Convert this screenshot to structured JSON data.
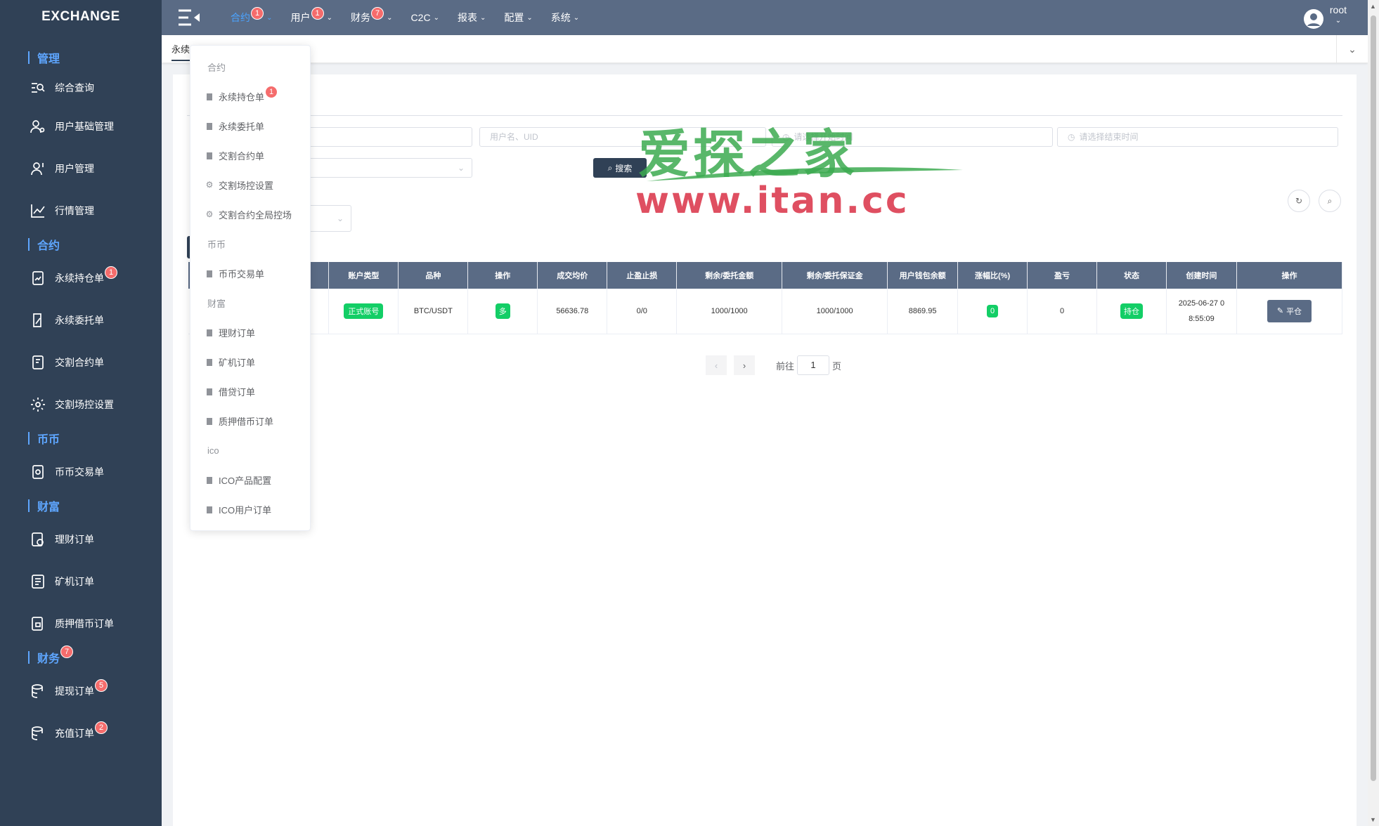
{
  "app": {
    "title": "EXCHANGE"
  },
  "sidebar": {
    "groups": [
      {
        "label": "管理",
        "items": [
          {
            "label": "综合查询",
            "icon": "search-list-icon"
          },
          {
            "label": "用户基础管理",
            "icon": "user-gear-icon"
          },
          {
            "label": "用户管理",
            "icon": "user-icon"
          },
          {
            "label": "行情管理",
            "icon": "line-chart-icon"
          }
        ]
      },
      {
        "label": "合约",
        "items": [
          {
            "label": "永续持仓单",
            "icon": "doc-chart-icon",
            "badge": "1"
          },
          {
            "label": "永续委托单",
            "icon": "doc-pen-icon"
          },
          {
            "label": "交割合约单",
            "icon": "doc-icon"
          },
          {
            "label": "交割场控设置",
            "icon": "gear-icon"
          }
        ]
      },
      {
        "label": "币币",
        "items": [
          {
            "label": "币币交易单",
            "icon": "doc-coin-icon"
          }
        ]
      },
      {
        "label": "财富",
        "items": [
          {
            "label": "理财订单",
            "icon": "doc-money-icon"
          },
          {
            "label": "矿机订单",
            "icon": "doc-list-icon"
          },
          {
            "label": "质押借币订单",
            "icon": "doc-lock-icon"
          }
        ]
      },
      {
        "label": "财务",
        "badge": "7",
        "items": [
          {
            "label": "提现订单",
            "icon": "database-icon",
            "badge": "5"
          },
          {
            "label": "充值订单",
            "icon": "database-icon",
            "badge": "2"
          }
        ]
      }
    ]
  },
  "navbar": {
    "items": [
      {
        "label": "合约",
        "badge": "1",
        "active": true
      },
      {
        "label": "用户",
        "badge": "1"
      },
      {
        "label": "财务",
        "badge": "7"
      },
      {
        "label": "C2C"
      },
      {
        "label": "报表"
      },
      {
        "label": "配置"
      },
      {
        "label": "系统"
      }
    ],
    "user": {
      "name": "root"
    }
  },
  "tags": {
    "active": "永续"
  },
  "filters": {
    "user_placeholder": "用户名、UID",
    "start_placeholder": "请选择开始时间",
    "end_placeholder": "请选择结束时间",
    "search_label": "搜索"
  },
  "table": {
    "headers": [
      "账户类型",
      "品种",
      "操作",
      "成交均价",
      "止盈止损",
      "剩余/委托金额",
      "剩余/委托保证金",
      "用户钱包余额",
      "涨幅比(%)",
      "盈亏",
      "状态",
      "创建时间",
      "操作"
    ],
    "row": {
      "account_type": "正式账号",
      "symbol": "BTC/USDT",
      "direction": "多",
      "avg_price": "56636.78",
      "tp_sl": "0/0",
      "remain_amount": "1000/1000",
      "remain_margin": "1000/1000",
      "wallet_balance": "8869.95",
      "change_pct": "0",
      "pnl": "0",
      "status": "持仓",
      "created_line1": "2025-06-27 0",
      "created_line2": "8:55:09",
      "action": "平仓"
    }
  },
  "pager": {
    "goto_label": "前往",
    "page": "1",
    "page_suffix": "页"
  },
  "dropdown": {
    "rows": [
      {
        "type": "head",
        "label": "合约"
      },
      {
        "type": "item",
        "label": "永续持仓单",
        "icon": "clipboard-icon",
        "badge": "1"
      },
      {
        "type": "item",
        "label": "永续委托单",
        "icon": "clipboard-icon"
      },
      {
        "type": "item",
        "label": "交割合约单",
        "icon": "clipboard-icon"
      },
      {
        "type": "item",
        "label": "交割场控设置",
        "icon": "gear-icon"
      },
      {
        "type": "item",
        "label": "交割合约全局控场",
        "icon": "gear-icon"
      },
      {
        "type": "head",
        "label": "币币"
      },
      {
        "type": "item",
        "label": "币币交易单",
        "icon": "clipboard-icon"
      },
      {
        "type": "head",
        "label": "财富"
      },
      {
        "type": "item",
        "label": "理财订单",
        "icon": "clipboard-icon"
      },
      {
        "type": "item",
        "label": "矿机订单",
        "icon": "clipboard-icon"
      },
      {
        "type": "item",
        "label": "借贷订单",
        "icon": "clipboard-icon"
      },
      {
        "type": "item",
        "label": "质押借币订单",
        "icon": "clipboard-icon"
      },
      {
        "type": "head",
        "label": "ico"
      },
      {
        "type": "item",
        "label": "ICO产品配置",
        "icon": "clipboard-icon"
      },
      {
        "type": "item",
        "label": "ICO用户订单",
        "icon": "clipboard-icon"
      }
    ]
  },
  "watermark": {
    "top": "爱探之家",
    "bottom": "www.itan.cc"
  },
  "colors": {
    "sidebar_bg": "#304156",
    "navbar_bg": "#5a6b85",
    "accent": "#4ba3ff",
    "success": "#13ce66",
    "badge": "#f56c6c"
  }
}
